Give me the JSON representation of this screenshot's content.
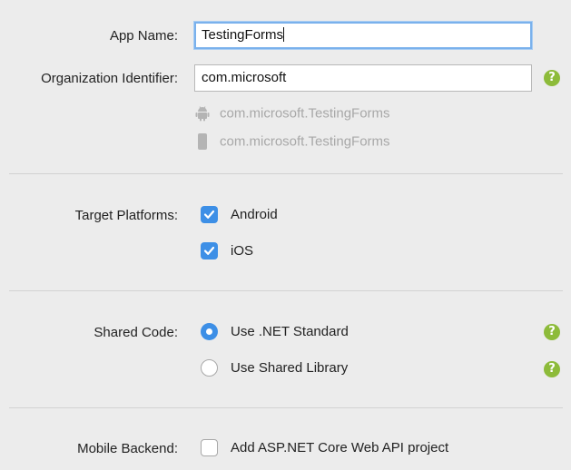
{
  "app_name": {
    "label": "App Name:",
    "value": "TestingForms"
  },
  "organization": {
    "label": "Organization Identifier:",
    "value": "com.microsoft"
  },
  "bundle_ids": {
    "android": "com.microsoft.TestingForms",
    "ios": "com.microsoft.TestingForms"
  },
  "target_platforms": {
    "label": "Target Platforms:",
    "options": [
      {
        "label": "Android",
        "checked": true
      },
      {
        "label": "iOS",
        "checked": true
      }
    ]
  },
  "shared_code": {
    "label": "Shared Code:",
    "options": [
      {
        "label": "Use .NET Standard",
        "selected": true
      },
      {
        "label": "Use Shared Library",
        "selected": false
      }
    ]
  },
  "mobile_backend": {
    "label": "Mobile Backend:",
    "option": {
      "label": "Add ASP.NET Core Web API project",
      "checked": false
    }
  },
  "help_glyph": "?",
  "colors": {
    "accent": "#3d8fe6",
    "help": "#8dbb3a",
    "focus": "#7ab1ec"
  }
}
